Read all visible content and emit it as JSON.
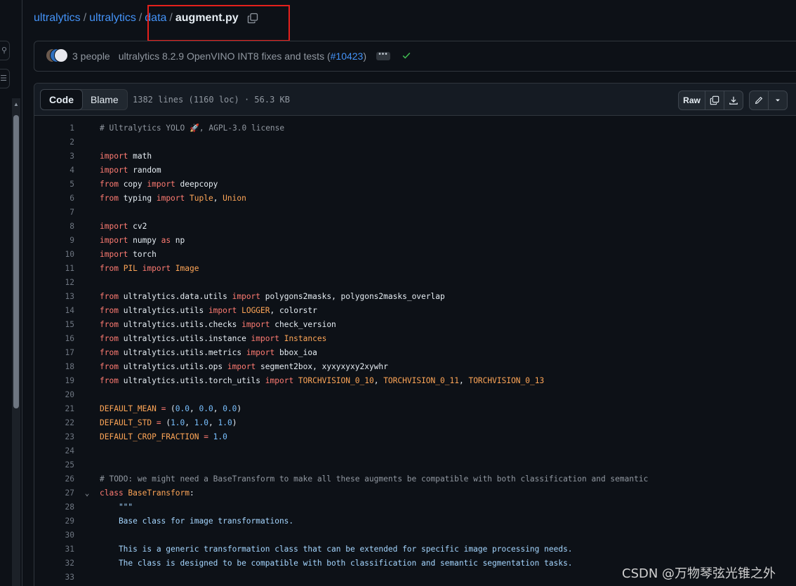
{
  "breadcrumb": {
    "items": [
      "ultralytics",
      "ultralytics",
      "data"
    ],
    "separator": "/",
    "current": "augment.py"
  },
  "commit": {
    "people": "3 people",
    "message": "ultralytics 8.2.9 OpenVINO INT8 fixes and tests (",
    "link": "#10423",
    "message_end": ")",
    "ellipsis": "•••"
  },
  "file_header": {
    "tab_code": "Code",
    "tab_blame": "Blame",
    "meta": "1382 lines (1160 loc) · 56.3 KB",
    "raw_label": "Raw"
  },
  "code_lines": [
    {
      "n": "1",
      "t": [
        [
          "cm",
          "# Ultralytics YOLO 🚀, AGPL-3.0 license"
        ]
      ]
    },
    {
      "n": "2",
      "t": []
    },
    {
      "n": "3",
      "t": [
        [
          "kw",
          "import"
        ],
        [
          "src",
          " math"
        ]
      ]
    },
    {
      "n": "4",
      "t": [
        [
          "kw",
          "import"
        ],
        [
          "src",
          " random"
        ]
      ]
    },
    {
      "n": "5",
      "t": [
        [
          "kw",
          "from"
        ],
        [
          "src",
          " copy "
        ],
        [
          "kw",
          "import"
        ],
        [
          "src",
          " deepcopy"
        ]
      ]
    },
    {
      "n": "6",
      "t": [
        [
          "kw",
          "from"
        ],
        [
          "src",
          " typing "
        ],
        [
          "kw",
          "import"
        ],
        [
          "cls",
          " Tuple"
        ],
        [
          "src",
          ", "
        ],
        [
          "cls",
          "Union"
        ]
      ]
    },
    {
      "n": "7",
      "t": []
    },
    {
      "n": "8",
      "t": [
        [
          "kw",
          "import"
        ],
        [
          "src",
          " cv2"
        ]
      ]
    },
    {
      "n": "9",
      "t": [
        [
          "kw",
          "import"
        ],
        [
          "src",
          " numpy "
        ],
        [
          "kw",
          "as"
        ],
        [
          "src",
          " np"
        ]
      ]
    },
    {
      "n": "10",
      "t": [
        [
          "kw",
          "import"
        ],
        [
          "src",
          " torch"
        ]
      ]
    },
    {
      "n": "11",
      "t": [
        [
          "kw",
          "from"
        ],
        [
          "cls",
          " PIL "
        ],
        [
          "kw",
          "import"
        ],
        [
          "cls",
          " Image"
        ]
      ]
    },
    {
      "n": "12",
      "t": []
    },
    {
      "n": "13",
      "t": [
        [
          "kw",
          "from"
        ],
        [
          "src",
          " ultralytics.data.utils "
        ],
        [
          "kw",
          "import"
        ],
        [
          "src",
          " polygons2masks, polygons2masks_overlap"
        ]
      ]
    },
    {
      "n": "14",
      "t": [
        [
          "kw",
          "from"
        ],
        [
          "src",
          " ultralytics.utils "
        ],
        [
          "kw",
          "import"
        ],
        [
          "cls",
          " LOGGER"
        ],
        [
          "src",
          ", colorstr"
        ]
      ]
    },
    {
      "n": "15",
      "t": [
        [
          "kw",
          "from"
        ],
        [
          "src",
          " ultralytics.utils.checks "
        ],
        [
          "kw",
          "import"
        ],
        [
          "src",
          " check_version"
        ]
      ]
    },
    {
      "n": "16",
      "t": [
        [
          "kw",
          "from"
        ],
        [
          "src",
          " ultralytics.utils.instance "
        ],
        [
          "kw",
          "import"
        ],
        [
          "cls",
          " Instances"
        ]
      ]
    },
    {
      "n": "17",
      "t": [
        [
          "kw",
          "from"
        ],
        [
          "src",
          " ultralytics.utils.metrics "
        ],
        [
          "kw",
          "import"
        ],
        [
          "src",
          " bbox_ioa"
        ]
      ]
    },
    {
      "n": "18",
      "t": [
        [
          "kw",
          "from"
        ],
        [
          "src",
          " ultralytics.utils.ops "
        ],
        [
          "kw",
          "import"
        ],
        [
          "src",
          " segment2box, xyxyxyxy2xywhr"
        ]
      ]
    },
    {
      "n": "19",
      "t": [
        [
          "kw",
          "from"
        ],
        [
          "src",
          " ultralytics.utils.torch_utils "
        ],
        [
          "kw",
          "import"
        ],
        [
          "cls",
          " TORCHVISION_0_10"
        ],
        [
          "src",
          ", "
        ],
        [
          "cls",
          "TORCHVISION_0_11"
        ],
        [
          "src",
          ", "
        ],
        [
          "cls",
          "TORCHVISION_0_13"
        ]
      ]
    },
    {
      "n": "20",
      "t": []
    },
    {
      "n": "21",
      "t": [
        [
          "cls",
          "DEFAULT_MEAN"
        ],
        [
          "kw",
          " ="
        ],
        [
          "src",
          " ("
        ],
        [
          "num",
          "0.0"
        ],
        [
          "src",
          ", "
        ],
        [
          "num",
          "0.0"
        ],
        [
          "src",
          ", "
        ],
        [
          "num",
          "0.0"
        ],
        [
          "src",
          ")"
        ]
      ]
    },
    {
      "n": "22",
      "t": [
        [
          "cls",
          "DEFAULT_STD"
        ],
        [
          "kw",
          " ="
        ],
        [
          "src",
          " ("
        ],
        [
          "num",
          "1.0"
        ],
        [
          "src",
          ", "
        ],
        [
          "num",
          "1.0"
        ],
        [
          "src",
          ", "
        ],
        [
          "num",
          "1.0"
        ],
        [
          "src",
          ")"
        ]
      ]
    },
    {
      "n": "23",
      "t": [
        [
          "cls",
          "DEFAULT_CROP_FRACTION"
        ],
        [
          "kw",
          " ="
        ],
        [
          "num",
          " 1.0"
        ]
      ]
    },
    {
      "n": "24",
      "t": []
    },
    {
      "n": "25",
      "t": []
    },
    {
      "n": "26",
      "t": [
        [
          "cm",
          "# TODO: we might need a BaseTransform to make all these augments be compatible with both classification and semantic"
        ]
      ]
    },
    {
      "n": "27",
      "fold": "⌄",
      "t": [
        [
          "kw",
          "class"
        ],
        [
          "cls",
          " BaseTransform"
        ],
        [
          "src",
          ":"
        ]
      ]
    },
    {
      "n": "28",
      "t": [
        [
          "st",
          "    \"\"\""
        ]
      ]
    },
    {
      "n": "29",
      "t": [
        [
          "st",
          "    Base class for image transformations."
        ]
      ]
    },
    {
      "n": "30",
      "t": []
    },
    {
      "n": "31",
      "t": [
        [
          "st",
          "    This is a generic transformation class that can be extended for specific image processing needs."
        ]
      ]
    },
    {
      "n": "32",
      "t": [
        [
          "st",
          "    The class is designed to be compatible with both classification and semantic segmentation tasks."
        ]
      ]
    },
    {
      "n": "33",
      "t": []
    }
  ],
  "watermark": "CSDN @万物琴弦光锥之外",
  "colors": {
    "accent": "#4493f8",
    "keyword": "#ff7b72",
    "constant": "#ffa657",
    "number": "#79c0ff",
    "string": "#a5d6ff",
    "success": "#3fb950",
    "annotation": "#e5201c"
  }
}
